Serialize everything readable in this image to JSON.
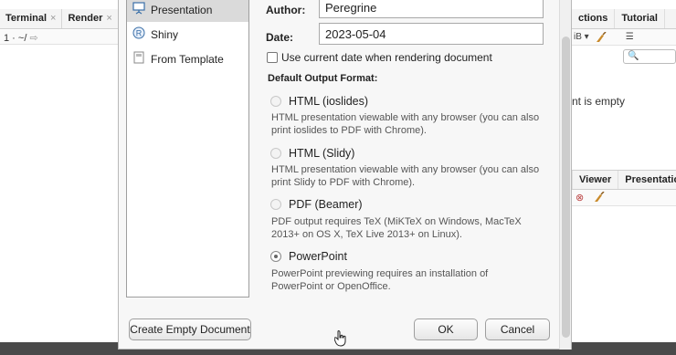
{
  "background": {
    "left_tabs": [
      {
        "label": "Terminal",
        "close": "×"
      },
      {
        "label": "Render",
        "close": "×"
      }
    ],
    "left_path": "1 · ~/",
    "right_tabs_top": [
      "ctions",
      "Tutorial"
    ],
    "right_tool_text": "iB ▾",
    "right_empty_text": "nt is empty",
    "right_tabs_bottom": [
      "Viewer",
      "Presentatio"
    ]
  },
  "dialog": {
    "sidebar": {
      "items": [
        {
          "label": "Presentation",
          "icon": "presentation-icon",
          "selected": true
        },
        {
          "label": "Shiny",
          "icon": "shiny-icon",
          "selected": false
        },
        {
          "label": "From Template",
          "icon": "template-icon",
          "selected": false
        }
      ]
    },
    "author": {
      "label": "Author:",
      "value": "Peregrine"
    },
    "date": {
      "label": "Date:",
      "value": "2023-05-04"
    },
    "use_current_date": {
      "label": "Use current date when rendering document",
      "checked": false
    },
    "format_heading": "Default Output Format:",
    "formats": [
      {
        "label": "HTML (ioslides)",
        "checked": false,
        "desc": [
          "HTML presentation viewable with any browser (you can also",
          "print ioslides to PDF with Chrome)."
        ]
      },
      {
        "label": "HTML (Slidy)",
        "checked": false,
        "desc": [
          "HTML presentation viewable with any browser (you can also",
          "print Slidy to PDF with Chrome)."
        ]
      },
      {
        "label": "PDF (Beamer)",
        "checked": false,
        "desc": [
          "PDF output requires TeX (MiKTeX on Windows, MacTeX",
          "2013+ on OS X, TeX Live 2013+ on Linux)."
        ]
      },
      {
        "label": "PowerPoint",
        "checked": true,
        "desc": [
          "PowerPoint previewing requires an installation of",
          "PowerPoint or OpenOffice."
        ]
      }
    ],
    "buttons": {
      "create_empty": "Create Empty Document",
      "ok": "OK",
      "cancel": "Cancel"
    }
  }
}
